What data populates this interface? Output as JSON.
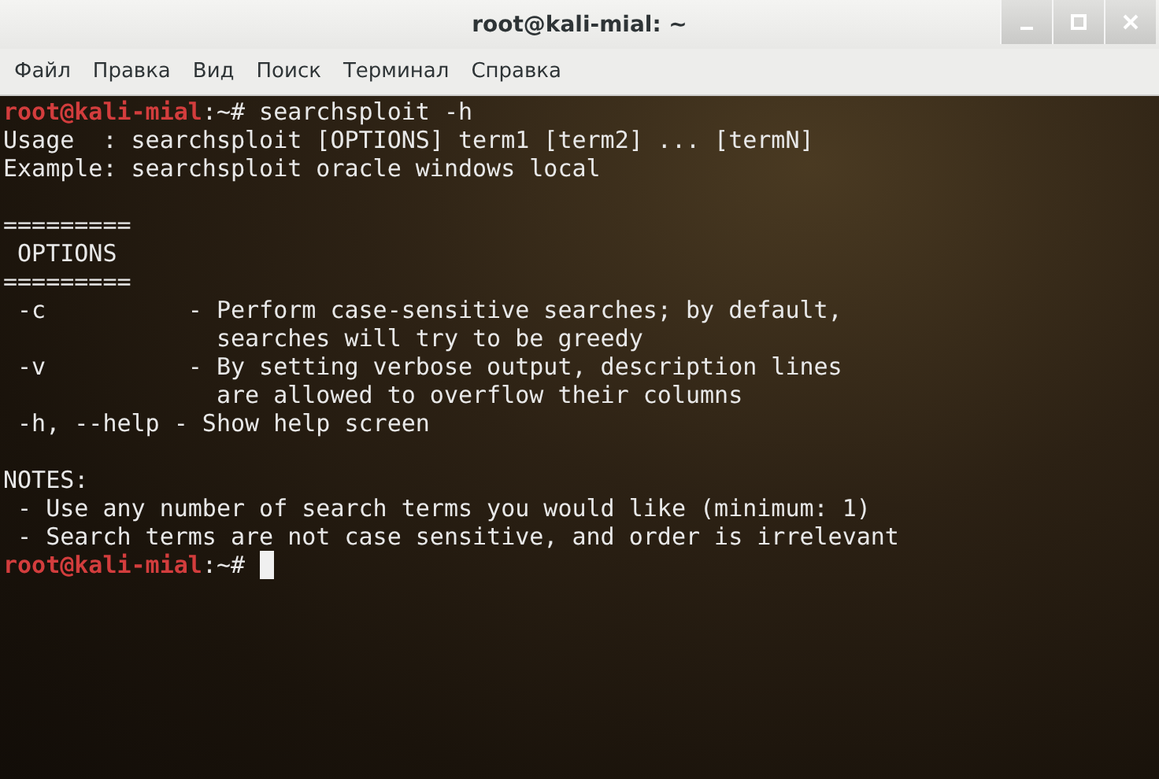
{
  "window": {
    "title": "root@kali-mial: ~"
  },
  "menu": [
    "Файл",
    "Правка",
    "Вид",
    "Поиск",
    "Терминал",
    "Справка"
  ],
  "terminal": {
    "lines": [
      {
        "kind": "prompt",
        "user_host": "root@kali-mial",
        "path": ":~#",
        "command": "searchsploit -h",
        "cursor": false
      },
      {
        "kind": "output",
        "text": "Usage  : searchsploit [OPTIONS] term1 [term2] ... [termN]"
      },
      {
        "kind": "output",
        "text": "Example: searchsploit oracle windows local"
      },
      {
        "kind": "blank"
      },
      {
        "kind": "output",
        "text": "========="
      },
      {
        "kind": "output",
        "text": " OPTIONS"
      },
      {
        "kind": "output",
        "text": "========="
      },
      {
        "kind": "output",
        "text": " -c          - Perform case-sensitive searches; by default,"
      },
      {
        "kind": "output",
        "text": "               searches will try to be greedy"
      },
      {
        "kind": "output",
        "text": " -v          - By setting verbose output, description lines"
      },
      {
        "kind": "output",
        "text": "               are allowed to overflow their columns"
      },
      {
        "kind": "output",
        "text": " -h, --help - Show help screen"
      },
      {
        "kind": "blank"
      },
      {
        "kind": "output",
        "text": "NOTES:"
      },
      {
        "kind": "output",
        "text": " - Use any number of search terms you would like (minimum: 1)"
      },
      {
        "kind": "output",
        "text": " - Search terms are not case sensitive, and order is irrelevant"
      },
      {
        "kind": "prompt",
        "user_host": "root@kali-mial",
        "path": ":~#",
        "cursor": true
      }
    ]
  }
}
